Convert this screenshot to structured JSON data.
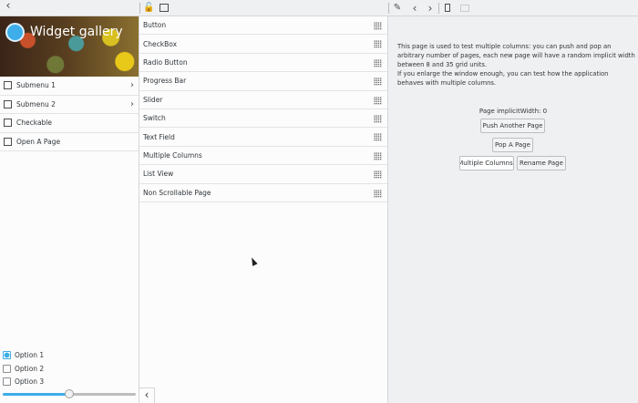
{
  "toolbar": {
    "back_icon": "chevron-left-icon",
    "lock_icon": "lock-icon",
    "image_icon": "image-icon",
    "edit_icon": "pencil-icon",
    "prev_icon": "chevron-left-icon",
    "next_icon": "chevron-right-icon",
    "bookmark_icon": "bookmark-icon",
    "folder_icon": "folder-icon"
  },
  "sidebar": {
    "title": "Widget gallery",
    "items": [
      {
        "label": "Submenu 1",
        "icon": "grid-icon",
        "has_arrow": true
      },
      {
        "label": "Submenu 2",
        "icon": "folder-icon",
        "has_arrow": true
      },
      {
        "label": "Checkable",
        "icon": "checklist-icon"
      },
      {
        "label": "Open A Page",
        "icon": "window-icon"
      }
    ],
    "options": [
      {
        "label": "Option 1",
        "checked": true
      },
      {
        "label": "Option 2",
        "checked": false
      },
      {
        "label": "Option 3",
        "checked": false
      }
    ],
    "slider_value": 0.5,
    "accent": "#3daee9"
  },
  "list": {
    "items": [
      "Button",
      "CheckBox",
      "Radio Button",
      "Progress Bar",
      "Slider",
      "Switch",
      "Text Field",
      "Multiple Columns",
      "List View",
      "Non Scrollable Page"
    ]
  },
  "page": {
    "description": "This page is used to test multiple columns: you can push and pop an arbitrary number of pages, each new page will have a random implicit width between 8 and 35 grid units.\nIf you enlarge the window enough, you can test how the application behaves with multiple columns.",
    "width_label": "Page implicitWidth: 0",
    "push_button": "Push Another Page",
    "pop_button": "Pop A Page",
    "columns_field": "Multiple Columns",
    "rename_button": "Rename Page"
  }
}
